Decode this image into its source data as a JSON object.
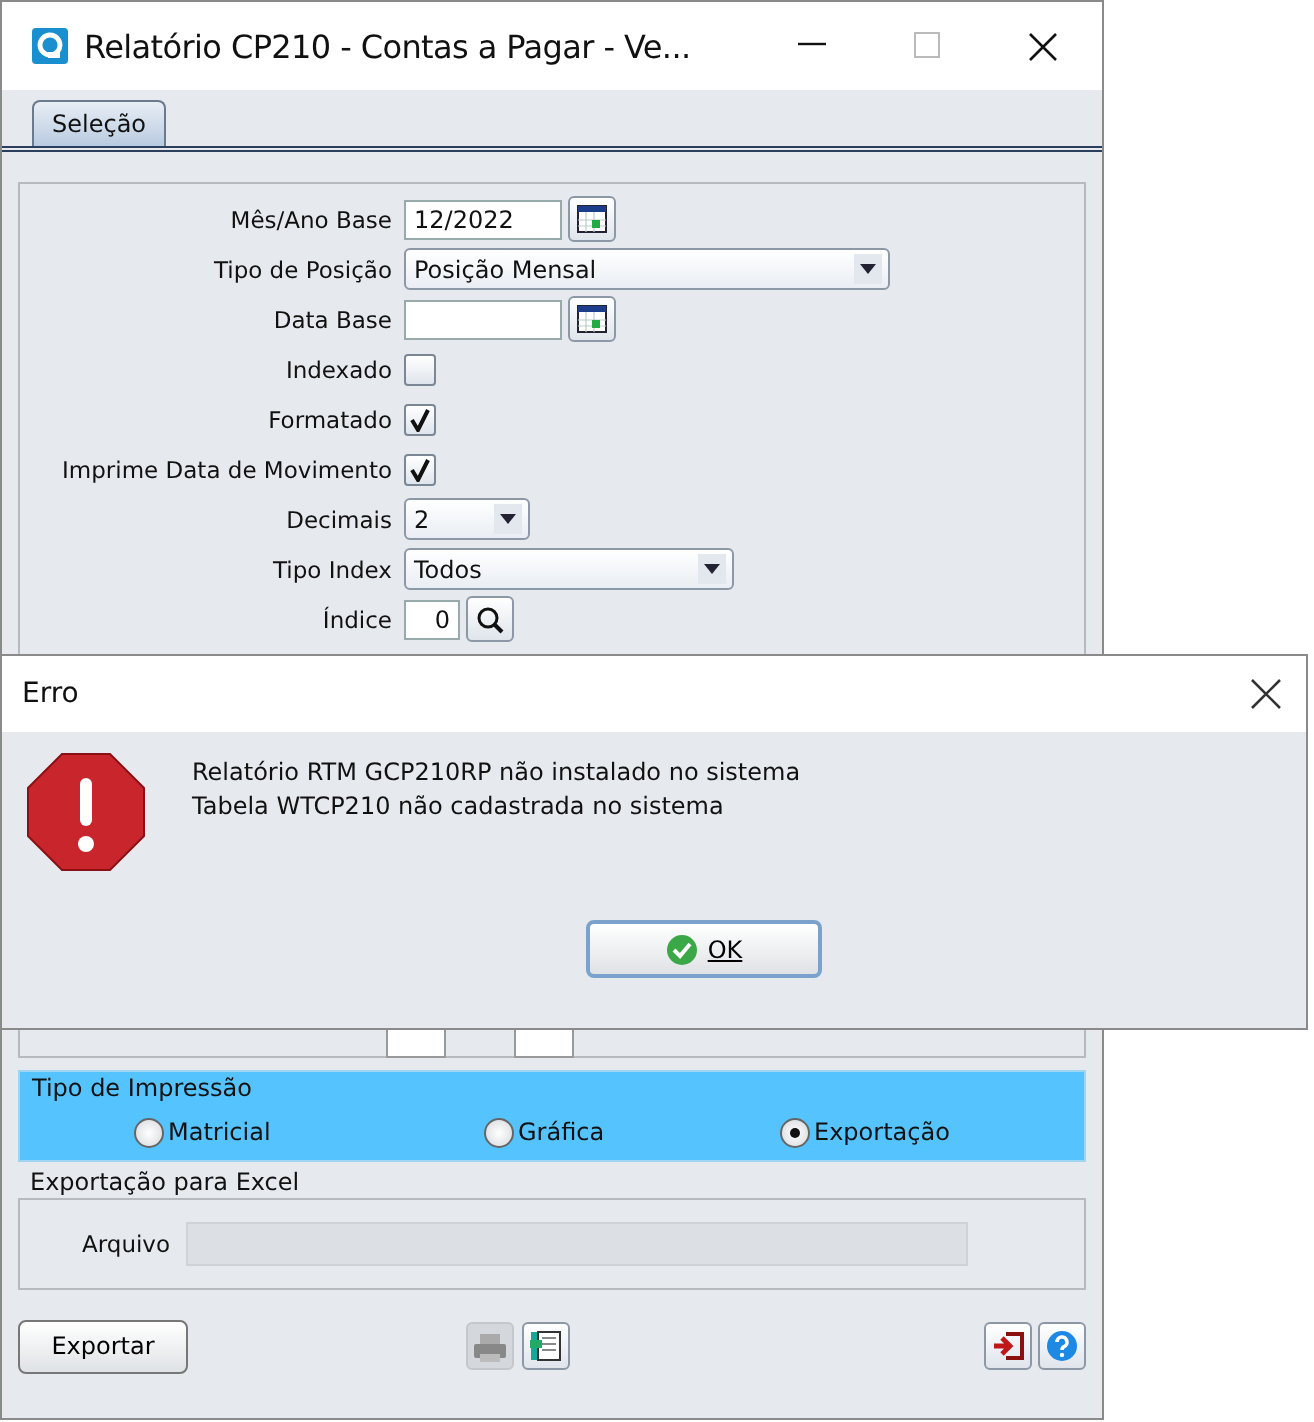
{
  "window": {
    "title": "Relatório CP210 - Contas a Pagar - Ve..."
  },
  "tabs": [
    {
      "label": "Seleção",
      "selected": true
    }
  ],
  "fields": [
    {
      "kind": "date",
      "label": "Mês/Ano Base",
      "value": "12/2022"
    },
    {
      "kind": "select",
      "label": "Tipo de Posição",
      "value": "Posição Mensal"
    },
    {
      "kind": "date",
      "label": "Data Base"
    },
    {
      "kind": "checkbox",
      "label": "Indexado",
      "checked": false
    },
    {
      "kind": "checkbox",
      "label": "Formatado",
      "checked": true
    },
    {
      "kind": "checkbox",
      "label": "Imprime Data de Movimento",
      "checked": true
    },
    {
      "kind": "select",
      "label": "Decimais",
      "value": "2"
    },
    {
      "kind": "select",
      "label": "Tipo Index",
      "value": "Todos"
    },
    {
      "kind": "lookup",
      "label": "Índice",
      "value": "0"
    }
  ],
  "print_type": {
    "title": "Tipo de Impressão",
    "options": [
      {
        "label": "Matricial",
        "selected": false
      },
      {
        "label": "Gráfica",
        "selected": false
      },
      {
        "label": "Exportação",
        "selected": true
      }
    ]
  },
  "export": {
    "title": "Exportação para Excel",
    "file_label": "Arquivo"
  },
  "export_button": "Exportar",
  "dialog": {
    "title": "Erro",
    "messages": [
      "Relatório RTM GCP210RP não instalado no sistema",
      "Tabela WTCP210 não cadastrada no sistema"
    ],
    "ok": "OK"
  }
}
